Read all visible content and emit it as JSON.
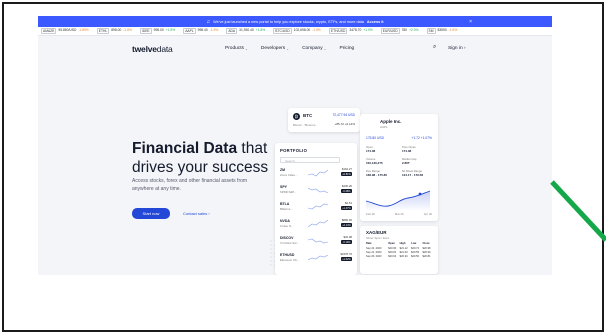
{
  "banner": {
    "text": "We've just launched a new portal to help you explore stocks, crypto, ETFs, and more data",
    "link": "Access it",
    "close": "×"
  },
  "ticker": [
    {
      "sym": "AMAZE",
      "price": "95.850/USD",
      "chg": "-1.85%",
      "up": false
    },
    {
      "sym": "ETHL",
      "price": "898.00",
      "chg": "-1.8%",
      "up": false
    },
    {
      "sym": "IDEE",
      "price": "998.00",
      "chg": "+1.5%",
      "up": true
    },
    {
      "sym": "AAPL",
      "price": "998.40",
      "chg": "-1.5%",
      "up": false
    },
    {
      "sym": "ADA",
      "price": "31,930.40",
      "chg": "+1.8%",
      "up": true
    },
    {
      "sym": "BTC/USD",
      "price": "102,698.00",
      "chg": "-1.6%",
      "up": false
    },
    {
      "sym": "ETH/USD",
      "price": "3478.70",
      "chg": "+1.0%",
      "up": true
    },
    {
      "sym": "EUR/USD",
      "price": "780",
      "chg": "+2.0%",
      "up": true
    },
    {
      "sym": "SM",
      "price": "$3590",
      "chg": "-1.6%",
      "up": false
    }
  ],
  "nav": {
    "logo_bold": "twelve",
    "logo_light": "data",
    "items": [
      "Products",
      "Developers",
      "Company",
      "Pricing"
    ],
    "signin": "Sign in"
  },
  "hero": {
    "title_bold": "Financial Data",
    "title_rest": " that drives your success",
    "subtitle": "Access stocks, forex and other financial assets from anywhere at any time.",
    "cta_primary": "Start now",
    "cta_secondary": "Contact sales ›"
  },
  "btc": {
    "symbol": "BTC",
    "subtitle": "Bitcoin · Binance",
    "price": "72,477.94 USD",
    "change": "+85.72 +0.12%"
  },
  "portfolio": {
    "title": "PORTFOLIO",
    "search_placeholder": "Search...",
    "rows": [
      {
        "sym": "ZM",
        "name": "Zoom Video...",
        "price": "$162.27",
        "chg": "+0.81%"
      },
      {
        "sym": "SPY",
        "name": "SPDR S&P...",
        "price": "$430.26",
        "chg": "-0.46%"
      },
      {
        "sym": "BTLA",
        "name": "Bitfarms...",
        "price": "$2.51",
        "chg": "+1.47%"
      },
      {
        "sym": "NVDA",
        "name": "Cruise N...",
        "price": "$890.45",
        "chg": "+2.14%"
      },
      {
        "sym": "DISCOV",
        "name": "Vt Online Svc...",
        "price": "$32.08",
        "chg": "-0.10%"
      },
      {
        "sym": "ETHUSD",
        "name": "Ethereum US...",
        "price": "$3478.70",
        "chg": "+1.02%"
      }
    ]
  },
  "aapl": {
    "logo": "",
    "name": "Apple Inc.",
    "sub": "AAPL",
    "price": "175.80 USD",
    "change": "+1.72 +1.07%",
    "stats": [
      {
        "label": "Open",
        "value": "174.08"
      },
      {
        "label": "Prev Close",
        "value": "174.08"
      },
      {
        "label": "Volume",
        "value": "100,136,275"
      },
      {
        "label": "Market Cap",
        "value": "2.86T"
      },
      {
        "label": "Day Range",
        "value": "168.98 - 175.80"
      },
      {
        "label": "52 Week Range",
        "value": "124.17 - 179.58"
      }
    ],
    "axis": [
      "Feb 28",
      "Mar 20",
      "Apr 30"
    ]
  },
  "fx": {
    "title": "XAG/EUR",
    "sub": "Silver Spot / Euro",
    "headers": [
      "Date",
      "Open",
      "High",
      "Low",
      "Close"
    ],
    "rows": [
      [
        "Sep 22, 2023",
        "$20.90",
        "$21.12",
        "$20.72",
        "$20.98"
      ],
      [
        "Sep 21, 2023",
        "$20.81",
        "$21.03",
        "$20.55",
        "$20.90"
      ],
      [
        "Sep 20, 2023",
        "$20.64",
        "$20.94",
        "$20.50",
        "$20.81"
      ]
    ]
  },
  "colors": {
    "accent": "#2347d6",
    "banner": "#3c59ff",
    "arrow": "#15a84a"
  }
}
